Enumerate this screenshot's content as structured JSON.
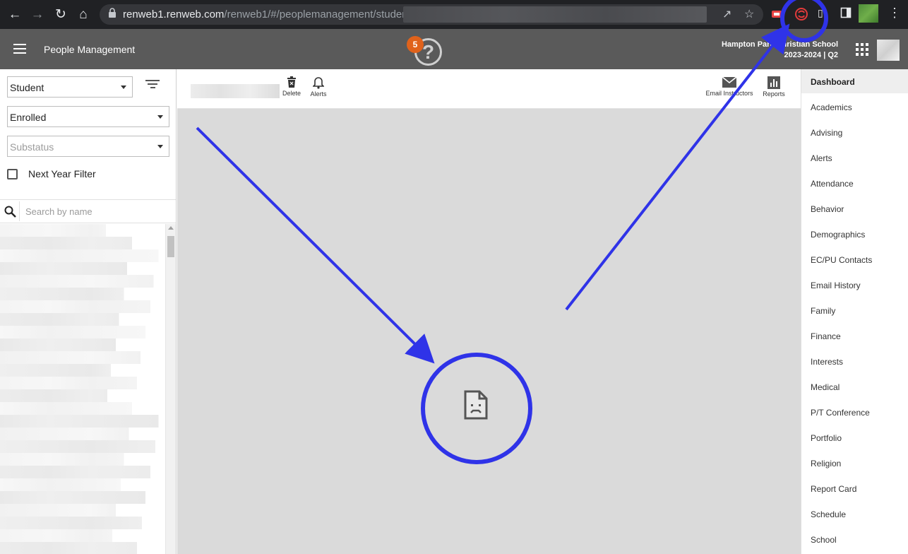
{
  "browser": {
    "url_host": "renweb1.renweb.com",
    "url_path": "/renweb1/#/peoplemanagement/student/",
    "icons": [
      "back-icon",
      "forward-icon",
      "reload-icon",
      "home-icon",
      "lock-icon",
      "share-icon",
      "star-icon",
      "extension-icon",
      "menu-icon"
    ]
  },
  "header": {
    "title": "People Management",
    "help_badge": "5",
    "school_name": "Hampton Park Christian School",
    "school_term": "2023-2024 | Q2"
  },
  "filters": {
    "person_type": "Student",
    "enrollment": "Enrolled",
    "substatus_placeholder": "Substatus",
    "next_year_label": "Next Year Filter",
    "search_placeholder": "Search by name"
  },
  "toolbar": {
    "delete_label": "Delete",
    "alerts_label": "Alerts",
    "email_label": "Email Instructors",
    "reports_label": "Reports"
  },
  "nav": {
    "items": [
      {
        "label": "Dashboard",
        "active": true
      },
      {
        "label": "Academics"
      },
      {
        "label": "Advising"
      },
      {
        "label": "Alerts"
      },
      {
        "label": "Attendance"
      },
      {
        "label": "Behavior"
      },
      {
        "label": "Demographics"
      },
      {
        "label": "EC/PU Contacts"
      },
      {
        "label": "Email History"
      },
      {
        "label": "Family"
      },
      {
        "label": "Finance"
      },
      {
        "label": "Interests"
      },
      {
        "label": "Medical"
      },
      {
        "label": "P/T Conference"
      },
      {
        "label": "Portfolio"
      },
      {
        "label": "Religion"
      },
      {
        "label": "Report Card"
      },
      {
        "label": "Schedule"
      },
      {
        "label": "School"
      }
    ]
  },
  "colors": {
    "annotation": "#2f33e8",
    "appbar": "#5a5a5a",
    "badge": "#e0621b"
  }
}
